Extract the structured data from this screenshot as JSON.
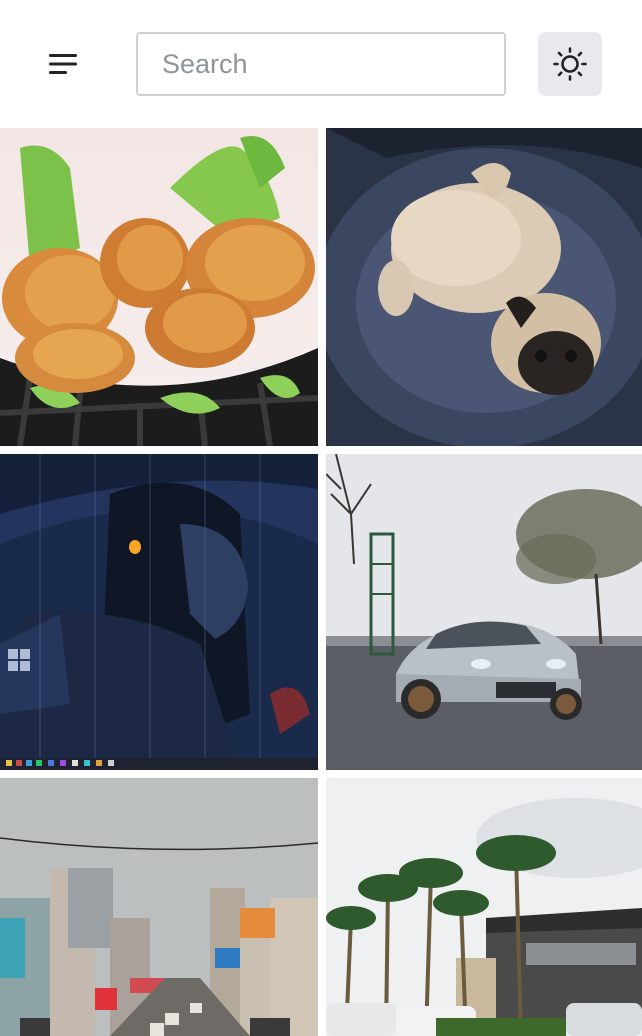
{
  "header": {
    "menu_icon": "hamburger-menu-icon",
    "search": {
      "placeholder": "Search",
      "value": ""
    },
    "theme_toggle_icon": "sun-icon"
  },
  "gallery": {
    "tiles": [
      {
        "subject": "fried-chicken-photo"
      },
      {
        "subject": "pug-on-cushion-photo"
      },
      {
        "subject": "anime-girl-rain-photo"
      },
      {
        "subject": "silver-sports-car-photo"
      },
      {
        "subject": "city-street-photo"
      },
      {
        "subject": "palm-trees-building-photo"
      }
    ]
  }
}
